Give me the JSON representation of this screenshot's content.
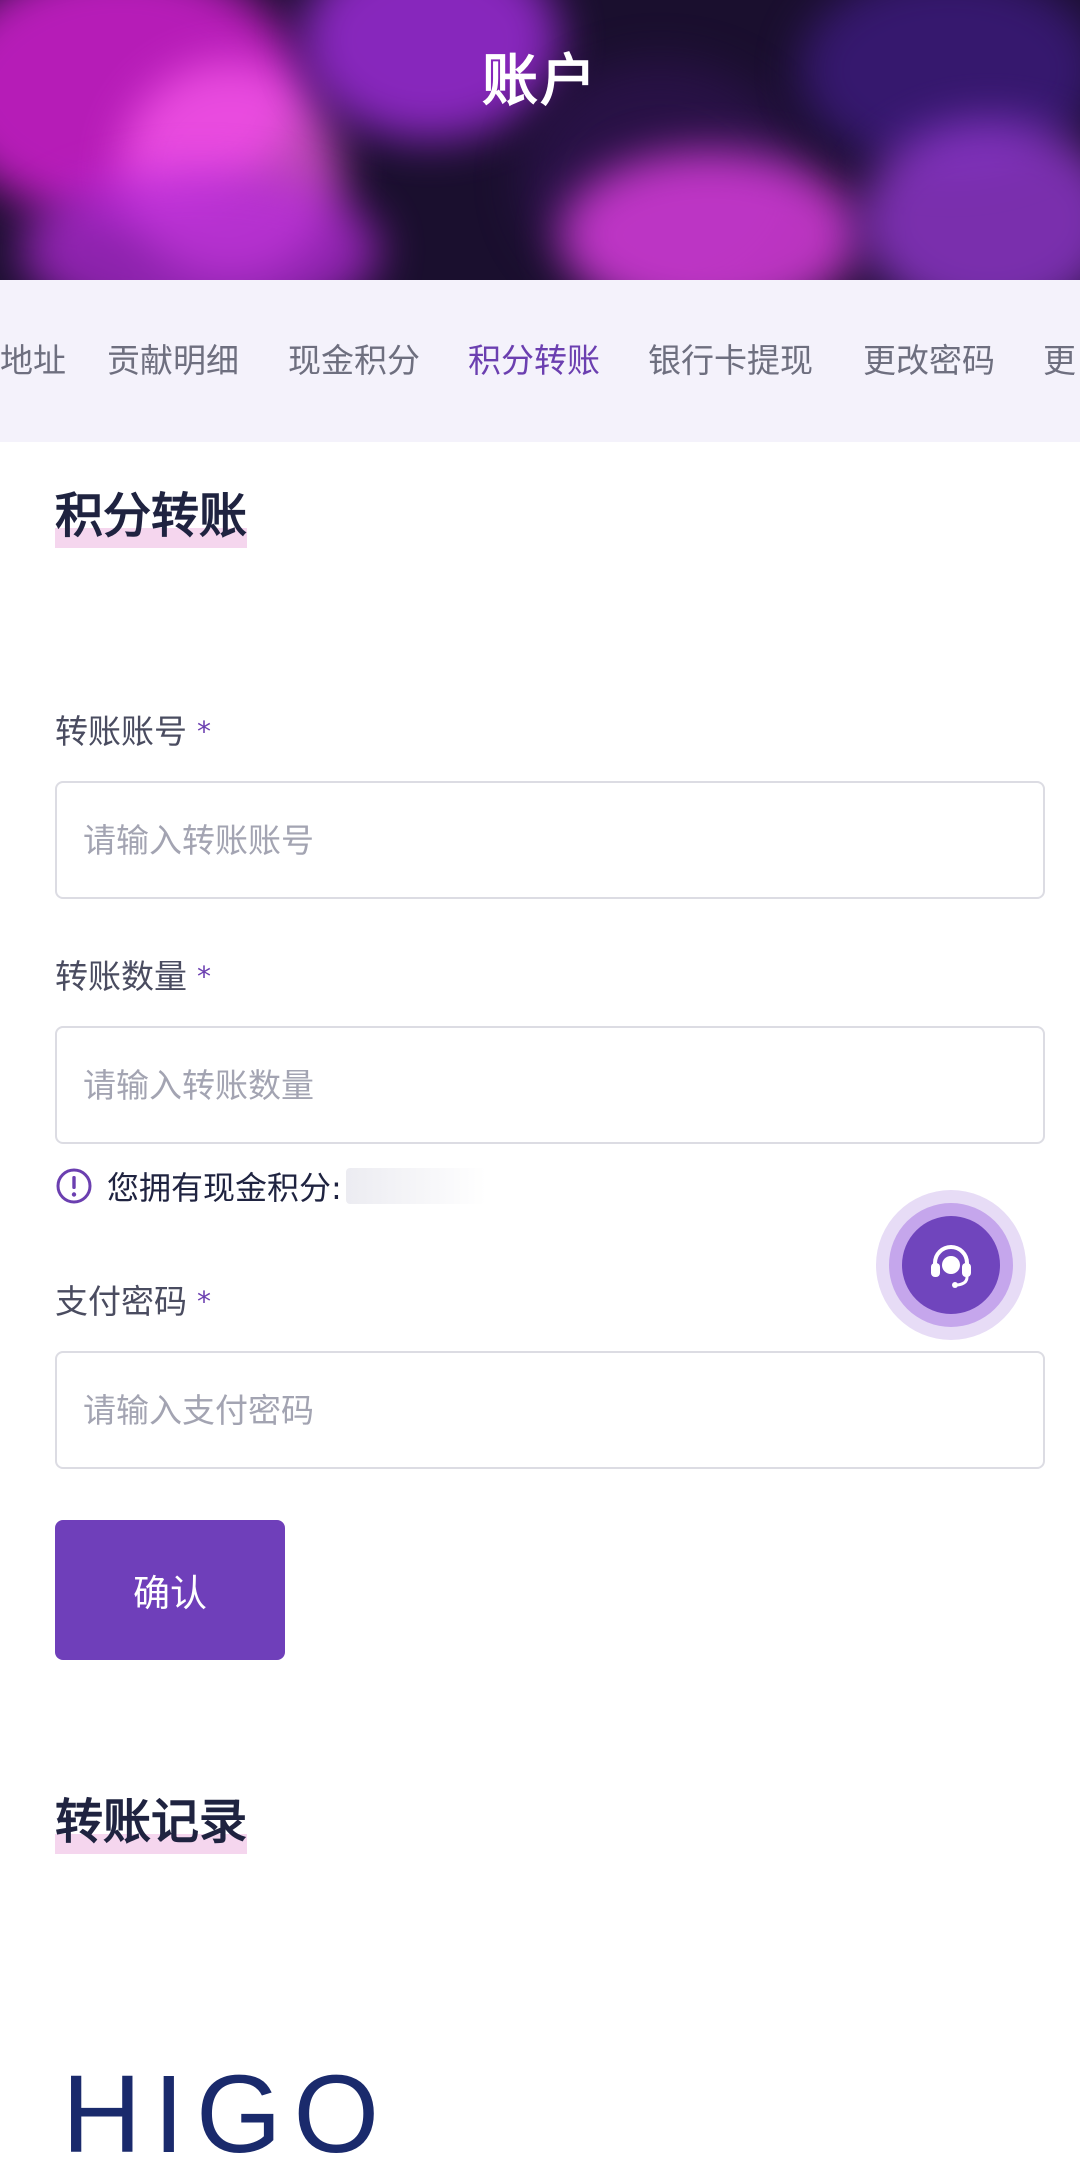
{
  "header": {
    "title": "账户"
  },
  "tabs": [
    {
      "label": "地址",
      "active": false
    },
    {
      "label": "贡献明细",
      "active": false
    },
    {
      "label": "现金积分",
      "active": false
    },
    {
      "label": "积分转账",
      "active": true
    },
    {
      "label": "银行卡提现",
      "active": false
    },
    {
      "label": "更改密码",
      "active": false
    },
    {
      "label": "更",
      "active": false
    }
  ],
  "transfer_section": {
    "title": "积分转账"
  },
  "form": {
    "account": {
      "label": "转账账号",
      "required_mark": "*",
      "placeholder": "请输入转账账号"
    },
    "amount": {
      "label": "转账数量",
      "required_mark": "*",
      "placeholder": "请输入转账数量"
    },
    "balance_hint": "您拥有现金积分:",
    "pay_password": {
      "label": "支付密码",
      "required_mark": "*",
      "placeholder": "请输入支付密码"
    },
    "confirm_label": "确认"
  },
  "records_section": {
    "title": "转账记录"
  },
  "footer": {
    "logo_text": "HIGO"
  },
  "colors": {
    "accent": "#6f3fba",
    "tab_active": "#6b3fb0",
    "highlight": "#f5d6ee"
  },
  "icons": {
    "info": "info-circle-icon",
    "support": "headset-icon"
  }
}
